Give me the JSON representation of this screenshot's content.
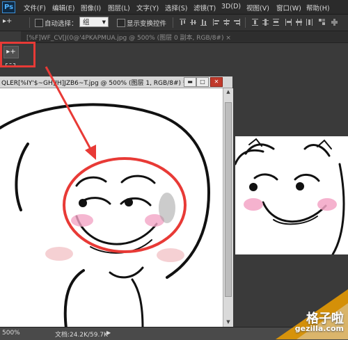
{
  "app": {
    "logo": "Ps"
  },
  "menu": [
    "文件(F)",
    "编辑(E)",
    "图像(I)",
    "图层(L)",
    "文字(Y)",
    "选择(S)",
    "滤镜(T)",
    "3D(D)",
    "视图(V)",
    "窗口(W)",
    "帮助(H)"
  ],
  "options": {
    "tool_glyph": "▸+",
    "auto_select_label": "自动选择：",
    "auto_select_value": "组",
    "show_transform_label": "显示变换控件"
  },
  "doc_tab": {
    "label": "[%F]WF_CV[J(0@'4PKAPMUA.jpg @ 500% (图层 0 副本, RGB/8#) ×"
  },
  "toolbox": {
    "move_glyph": "▸+"
  },
  "window1": {
    "title": "QLER[%IY'$~GH]JH]JZB6~T.jpg @ 500% (图层 1, RGB/8#) *",
    "minimize": "▬",
    "maximize": "□",
    "close": "✕"
  },
  "status": {
    "zoom": "500%",
    "doc": "文档:24.2K/59.7K",
    "arrow": "▶"
  },
  "watermark": {
    "title": "格子啦",
    "url": "gezilla.com"
  },
  "colors": {
    "highlight": "#e83a36",
    "blush": "#f3a5c6",
    "accent": "#4fb2ff"
  },
  "icons": [
    "move-tool-icon",
    "marquee-tool-icon",
    "align-icons",
    "dropdown-arrow-icon"
  ]
}
